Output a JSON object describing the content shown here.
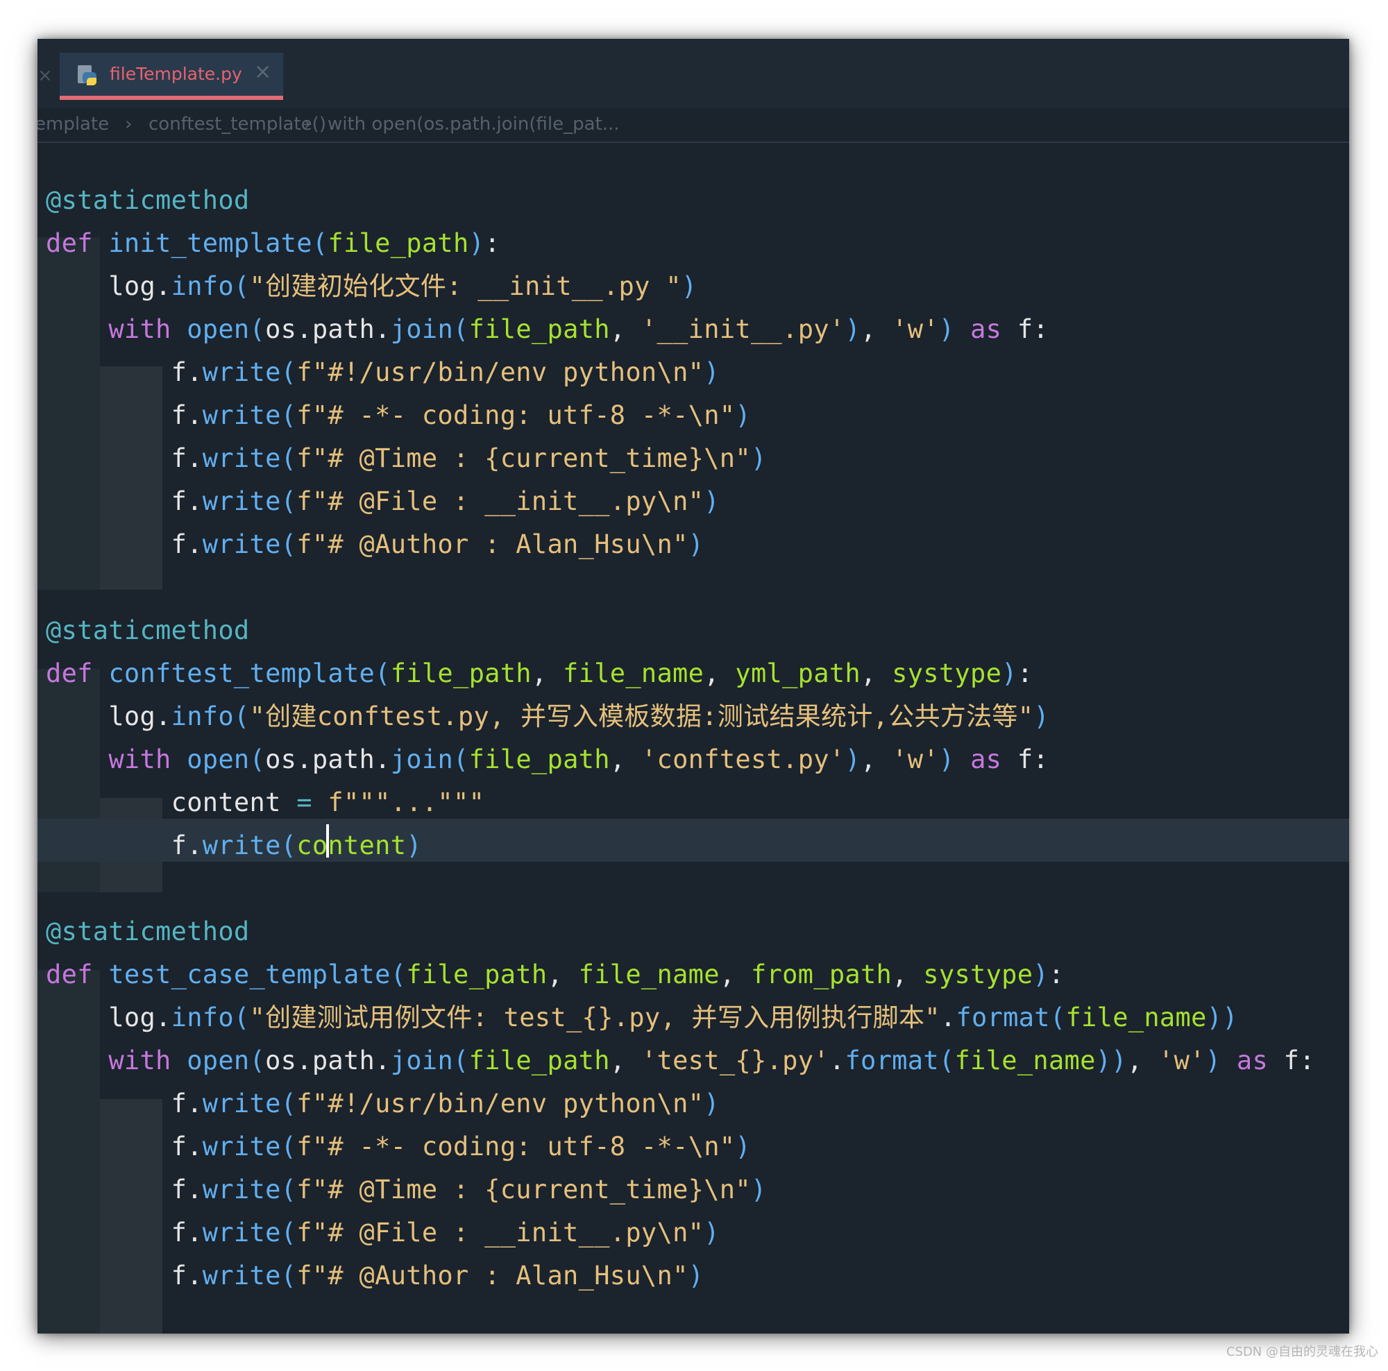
{
  "tab": {
    "title": "fileTemplate.py",
    "close_symbol": "×"
  },
  "left_close_symbol": "×",
  "breadcrumb": {
    "items": [
      "emplate",
      "conftest_template()",
      "with open(os.path.join(file_pat..."
    ],
    "separator": "›"
  },
  "code": {
    "lines": [
      "",
      "@staticmethod",
      "def init_template(file_path):",
      "    log.info(\"创建初始化文件: __init__.py \")",
      "    with open(os.path.join(file_path, '__init__.py'), 'w') as f:",
      "        f.write(f\"#!/usr/bin/env python\\n\")",
      "        f.write(f\"# -*- coding: utf-8 -*-\\n\")",
      "        f.write(f\"# @Time : {current_time}\\n\")",
      "        f.write(f\"# @File : __init__.py\\n\")",
      "        f.write(f\"# @Author : Alan_Hsu\\n\")",
      "",
      "@staticmethod",
      "def conftest_template(file_path, file_name, yml_path, systype):",
      "    log.info(\"创建conftest.py, 并写入模板数据:测试结果统计,公共方法等\")",
      "    with open(os.path.join(file_path, 'conftest.py'), 'w') as f:",
      "        content = f\"\"\"...\"\"\"",
      "        f.write(content)",
      "",
      "@staticmethod",
      "def test_case_template(file_path, file_name, from_path, systype):",
      "    log.info(\"创建测试用例文件: test_{}.py, 并写入用例执行脚本\".format(file_name))",
      "    with open(os.path.join(file_path, 'test_{}.py'.format(file_name)), 'w') as f:",
      "        f.write(f\"#!/usr/bin/env python\\n\")",
      "        f.write(f\"# -*- coding: utf-8 -*-\\n\")",
      "        f.write(f\"# @Time : {current_time}\\n\")",
      "        f.write(f\"# @File : __init__.py\\n\")",
      "        f.write(f\"# @Author : Alan_Hsu\\n\")"
    ],
    "current_line_index": 15
  },
  "watermark": "CSDN @自由的灵魂在我心",
  "colors": {
    "background": "#1b232d",
    "keyword": "#c678dd",
    "function": "#61afef",
    "string": "#e5c07b",
    "parameter": "#a6e22e",
    "decorator": "#56b6c2",
    "tab_accent": "#e06c75"
  }
}
